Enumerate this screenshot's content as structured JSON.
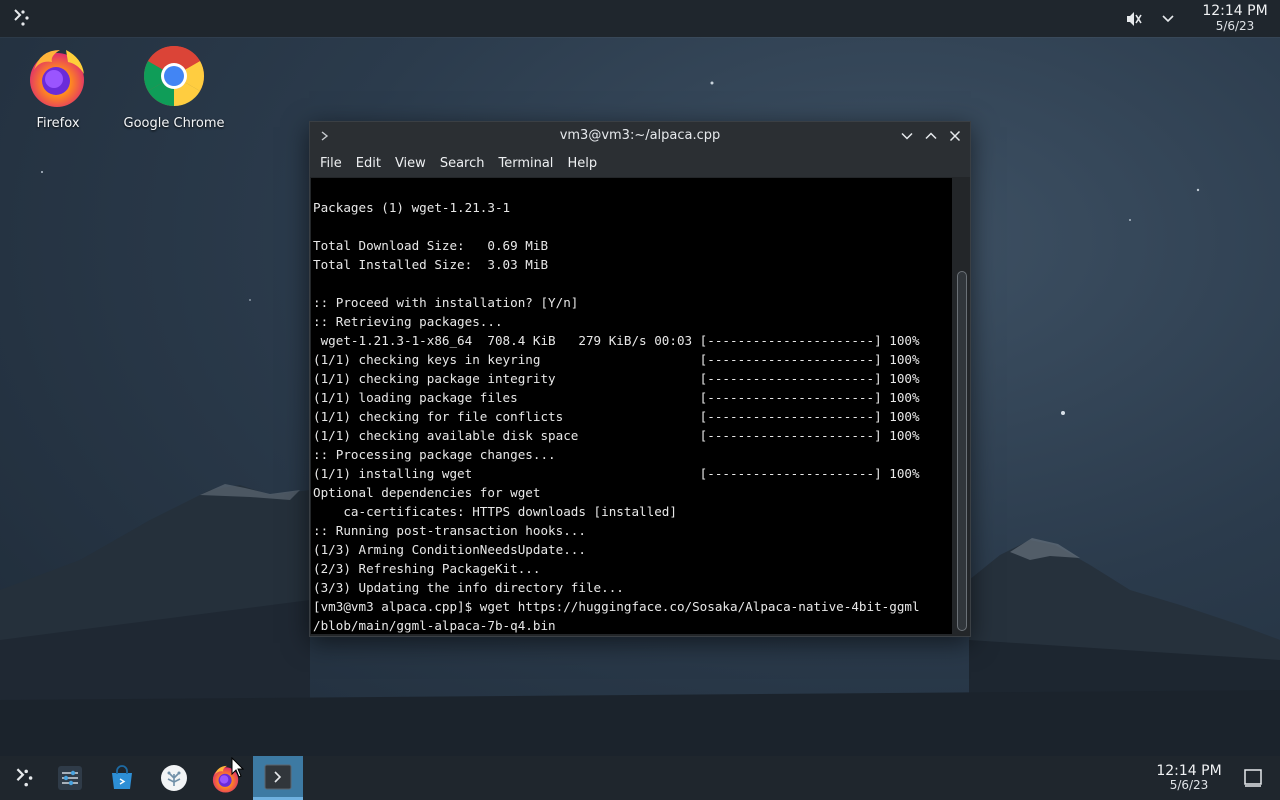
{
  "top_panel": {
    "time": "12:14 PM",
    "date": "5/6/23"
  },
  "desktop_icons": [
    {
      "label": "Firefox"
    },
    {
      "label": "Google Chrome"
    }
  ],
  "window": {
    "title": "vm3@vm3:~/alpaca.cpp",
    "menu": [
      "File",
      "Edit",
      "View",
      "Search",
      "Terminal",
      "Help"
    ],
    "terminal_lines": [
      "Packages (1) wget-1.21.3-1",
      "",
      "Total Download Size:   0.69 MiB",
      "Total Installed Size:  3.03 MiB",
      "",
      ":: Proceed with installation? [Y/n]",
      ":: Retrieving packages...",
      " wget-1.21.3-1-x86_64  708.4 KiB   279 KiB/s 00:03 [----------------------] 100%",
      "(1/1) checking keys in keyring                     [----------------------] 100%",
      "(1/1) checking package integrity                   [----------------------] 100%",
      "(1/1) loading package files                        [----------------------] 100%",
      "(1/1) checking for file conflicts                  [----------------------] 100%",
      "(1/1) checking available disk space                [----------------------] 100%",
      ":: Processing package changes...",
      "(1/1) installing wget                              [----------------------] 100%",
      "Optional dependencies for wget",
      "    ca-certificates: HTTPS downloads [installed]",
      ":: Running post-transaction hooks...",
      "(1/3) Arming ConditionNeedsUpdate...",
      "(2/3) Refreshing PackageKit...",
      "(3/3) Updating the info directory file...",
      "[vm3@vm3 alpaca.cpp]$ wget https://huggingface.co/Sosaka/Alpaca-native-4bit-ggml",
      "/blob/main/ggml-alpaca-7b-q4.bin"
    ]
  },
  "taskbar": {
    "time": "12:14 PM",
    "date": "5/6/23",
    "items": [
      "app-launcher",
      "system-settings",
      "discover",
      "kde-connect",
      "firefox",
      "konsole"
    ]
  }
}
